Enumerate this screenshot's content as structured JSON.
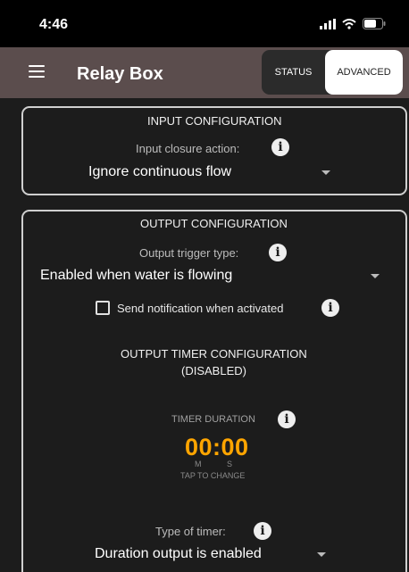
{
  "status_bar": {
    "time": "4:46"
  },
  "app_bar": {
    "title": "Relay Box"
  },
  "tabs": [
    {
      "label": "STATUS",
      "selected": false
    },
    {
      "label": "ADVANCED",
      "selected": true
    }
  ],
  "input_config": {
    "heading": "INPUT CONFIGURATION",
    "closure_label": "Input closure action:",
    "closure_value": "Ignore continuous flow"
  },
  "output_config": {
    "heading": "OUTPUT CONFIGURATION",
    "trigger_label": "Output trigger type:",
    "trigger_value": "Enabled when water is flowing",
    "notify_label": "Send notification when activated",
    "notify_checked": false,
    "timer_heading_line1": "OUTPUT TIMER CONFIGURATION",
    "timer_heading_line2": "(DISABLED)",
    "timer_duration_label": "TIMER DURATION",
    "timer_value": "00:00",
    "timer_unit_m": "M",
    "timer_unit_s": "S",
    "tap_to_change": "TAP TO CHANGE",
    "timer_type_label": "Type of timer:",
    "timer_type_value": "Duration output is enabled"
  },
  "colors": {
    "accent": "#ffa500",
    "app_bar": "#5b4d4d",
    "background": "#1c1c1c"
  }
}
